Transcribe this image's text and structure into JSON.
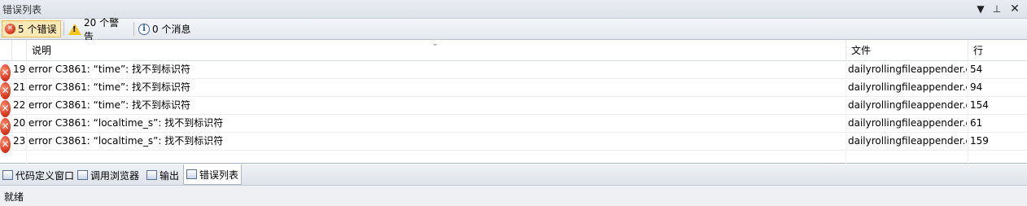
{
  "title": "错误列表",
  "title_buttons": {
    "dropdown": "▼",
    "pin": "⊥",
    "close": "✕"
  },
  "toolbar": {
    "errors_label": "5 个错误",
    "warnings_label": "20 个警告",
    "messages_label": "0 个消息"
  },
  "columns": {
    "description": "说明",
    "file": "文件",
    "line": "行"
  },
  "rows": [
    {
      "num": "19",
      "desc": "error C3861: “time”: 找不到标识符",
      "file": "dailyrollingfileappender.c",
      "line": "54"
    },
    {
      "num": "21",
      "desc": "error C3861: “time”: 找不到标识符",
      "file": "dailyrollingfileappender.c",
      "line": "94"
    },
    {
      "num": "22",
      "desc": "error C3861: “time”: 找不到标识符",
      "file": "dailyrollingfileappender.c",
      "line": "154"
    },
    {
      "num": "20",
      "desc": "error C3861: “localtime_s”: 找不到标识符",
      "file": "dailyrollingfileappender.c",
      "line": "61"
    },
    {
      "num": "23",
      "desc": "error C3861: “localtime_s”: 找不到标识符",
      "file": "dailyrollingfileappender.c",
      "line": "159"
    }
  ],
  "tabs": [
    {
      "label": "代码定义窗口",
      "icon": "code-definition-icon"
    },
    {
      "label": "调用浏览器",
      "icon": "call-browser-icon"
    },
    {
      "label": "输出",
      "icon": "output-icon"
    },
    {
      "label": "错误列表",
      "icon": "error-list-icon",
      "active": true
    }
  ],
  "status": "就绪",
  "colors": {
    "error": "#d5331b",
    "warning": "#f5c518",
    "selected": "#fbe9b5"
  }
}
